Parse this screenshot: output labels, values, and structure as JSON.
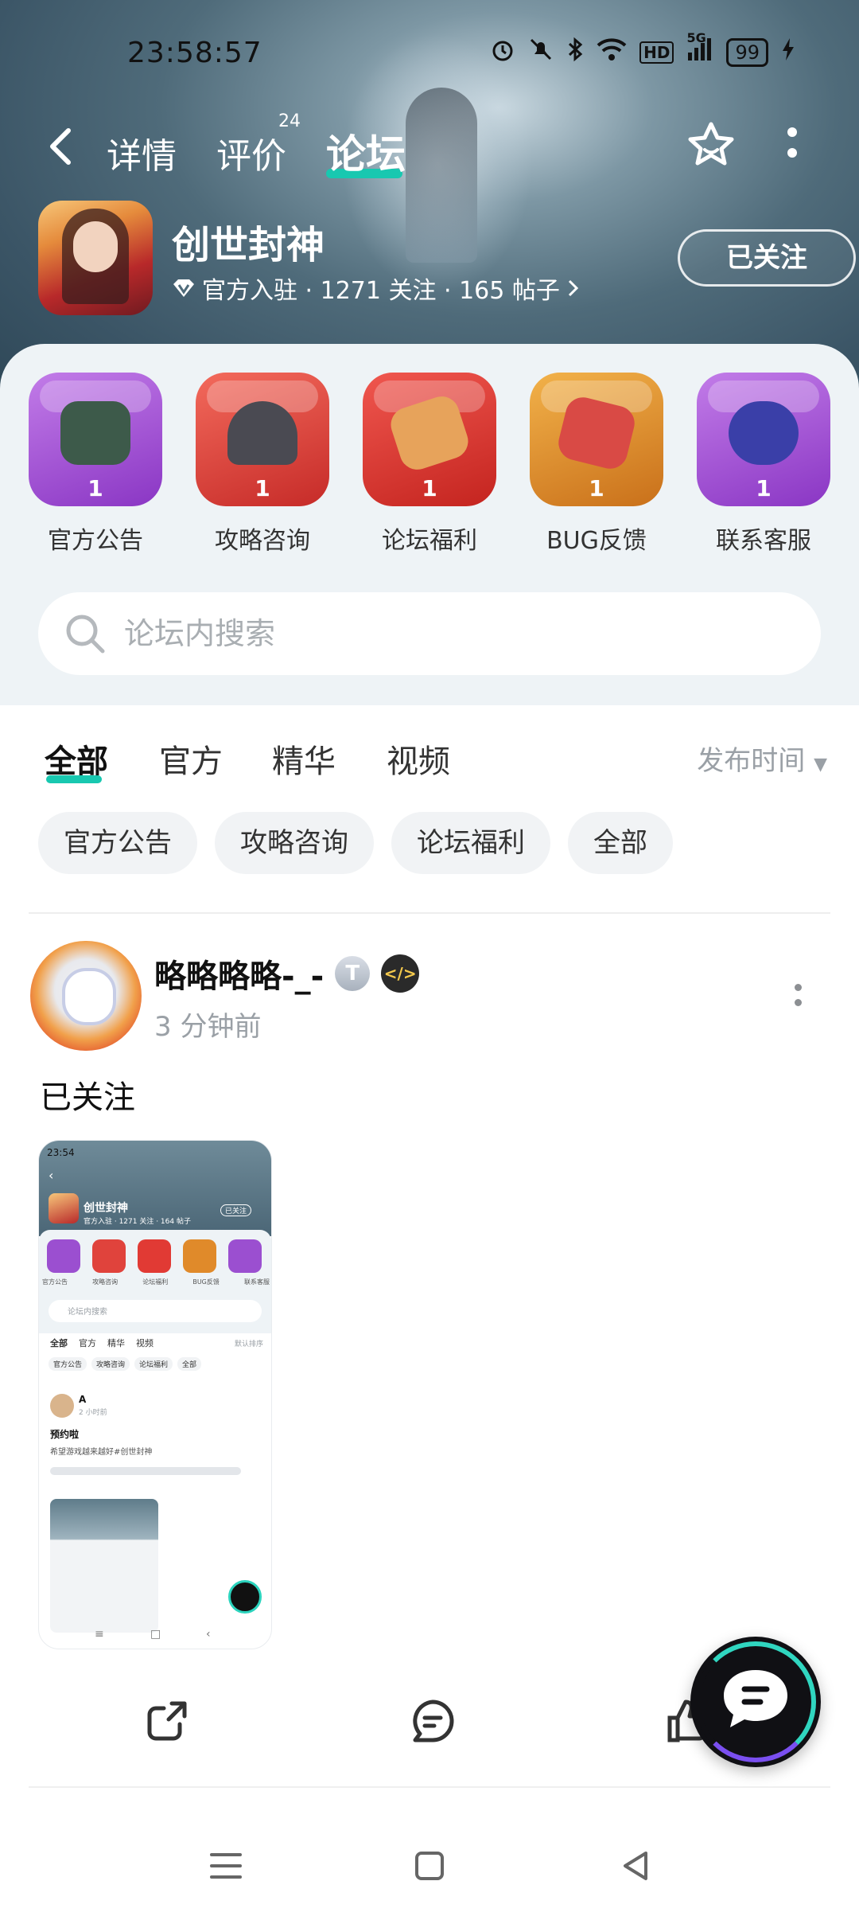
{
  "status_bar": {
    "time": "23:58:57",
    "battery": "99",
    "network_label": "5G",
    "hd_label": "HD"
  },
  "nav": {
    "tabs": [
      {
        "label": "详情",
        "active": false
      },
      {
        "label": "评价",
        "badge": "24",
        "active": false
      },
      {
        "label": "论坛",
        "active": true
      }
    ],
    "accent_color": "#18c8b0"
  },
  "game": {
    "name": "创世封神",
    "meta": "官方入驻 · 1271 关注 · 165 帖子",
    "follow_label": "已关注"
  },
  "quick_entries": [
    {
      "label": "官方公告",
      "count": "1",
      "icon": "bronze-vessel-icon",
      "color": "#9b4fd0"
    },
    {
      "label": "攻略咨询",
      "count": "1",
      "icon": "cauldron-icon",
      "color": "#e0433c"
    },
    {
      "label": "论坛福利",
      "count": "1",
      "icon": "ore-chunk-icon",
      "color": "#e13a34"
    },
    {
      "label": "BUG反馈",
      "count": "1",
      "icon": "meat-ore-icon",
      "color": "#e08a2a"
    },
    {
      "label": "联系客服",
      "count": "1",
      "icon": "ssr-card-icon",
      "color": "#9b4fd0"
    }
  ],
  "search": {
    "placeholder": "论坛内搜索"
  },
  "filter_tabs": {
    "tabs": [
      "全部",
      "官方",
      "精华",
      "视频"
    ],
    "active": "全部",
    "sort_label": "发布时间"
  },
  "chips": [
    "官方公告",
    "攻略咨询",
    "论坛福利",
    "全部"
  ],
  "post": {
    "username": "略略略略-_-",
    "user_badge_text": "T",
    "time": "3 分钟前",
    "text": "已关注",
    "thumbnail": {
      "time": "23:54",
      "game_name": "创世封神",
      "follow_label": "已关注",
      "meta": "官方入驻 · 1271 关注 · 164 帖子",
      "search_placeholder": "论坛内搜索",
      "tabs": [
        "全部",
        "官方",
        "精华",
        "视频"
      ],
      "sort_label": "默认排序",
      "chips": [
        "官方公告",
        "攻略咨询",
        "论坛福利",
        "全部"
      ],
      "post_user": "A",
      "post_time": "2 小时前",
      "post_title": "预约啦",
      "post_body": "希望游戏越来越好#创世封神",
      "labels": [
        "官方公告",
        "攻略咨询",
        "论坛福利",
        "BUG反馈",
        "联系客服"
      ]
    }
  },
  "actions": {
    "share_icon": "share-icon",
    "comment_icon": "comment-icon",
    "like_icon": "thumbs-up-icon",
    "chat_fab_icon": "chat-bubble-icon"
  }
}
